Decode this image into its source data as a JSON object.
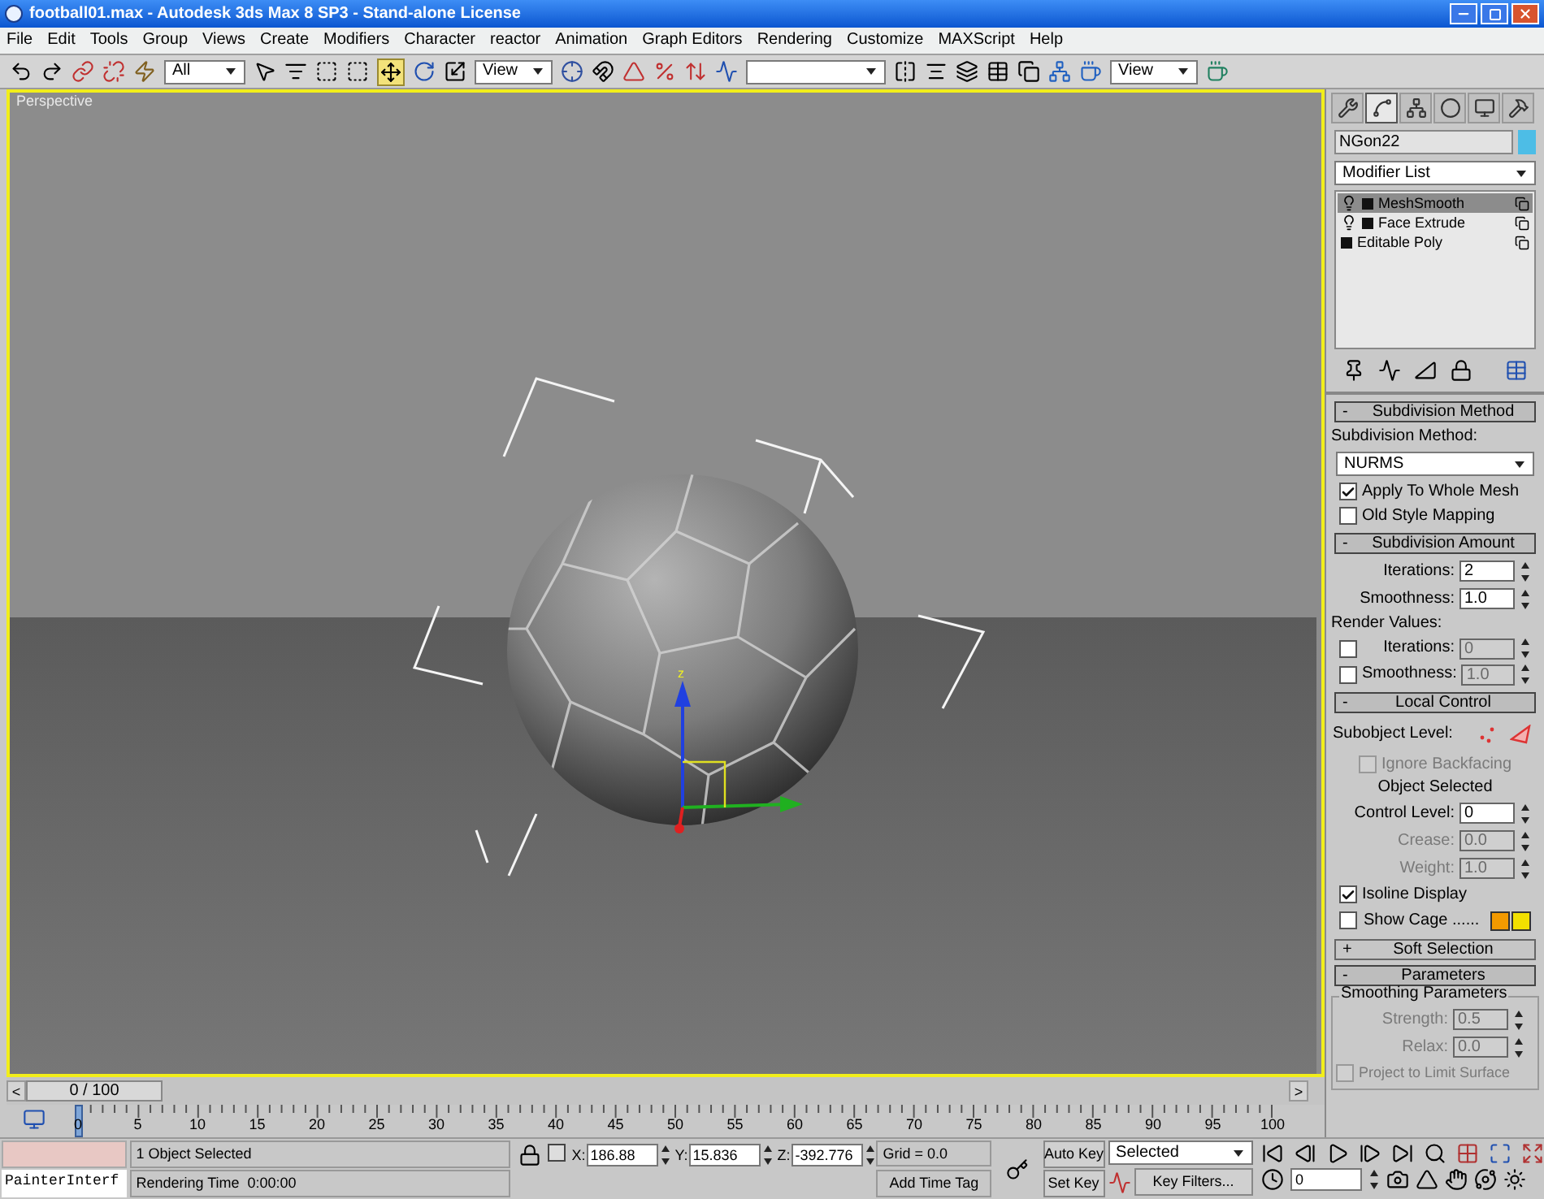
{
  "window": {
    "title": "football01.max - Autodesk 3ds Max 8 SP3  - Stand-alone License"
  },
  "menu": [
    "File",
    "Edit",
    "Tools",
    "Group",
    "Views",
    "Create",
    "Modifiers",
    "Character",
    "reactor",
    "Animation",
    "Graph Editors",
    "Rendering",
    "Customize",
    "MAXScript",
    "Help"
  ],
  "toolbar": {
    "selection_filter": "All",
    "reference_coordinate": "View",
    "render_viewport": "View"
  },
  "viewport": {
    "label": "Perspective",
    "gizmo_axis": "z"
  },
  "command_panel": {
    "tabs": [
      {
        "selected": false
      },
      {
        "selected": true
      },
      {
        "selected": false
      },
      {
        "selected": false
      },
      {
        "selected": false
      },
      {
        "selected": false
      }
    ],
    "object_name": "NGon22",
    "modifier_list": "Modifier List",
    "stack": [
      {
        "label": "MeshSmooth",
        "bulb": true,
        "selected": true
      },
      {
        "label": "Face Extrude",
        "bulb": true,
        "selected": false
      },
      {
        "label": "Editable Poly",
        "bulb": false,
        "selected": false
      }
    ],
    "rollouts": [
      {
        "sign": "-",
        "title": "Subdivision Method",
        "expanded": true,
        "controls": [
          {
            "kind": "label",
            "text": "Subdivision Method:"
          },
          {
            "kind": "dropdown",
            "value": "NURMS"
          },
          {
            "kind": "checkbox",
            "label": "Apply To Whole Mesh",
            "checked": true,
            "disabled": false
          },
          {
            "kind": "checkbox",
            "label": "Old Style Mapping",
            "checked": false,
            "disabled": false
          }
        ]
      },
      {
        "sign": "-",
        "title": "Subdivision Amount",
        "expanded": true,
        "controls": [
          {
            "kind": "spinner",
            "label": "Iterations:",
            "value": "2",
            "disabled": false
          },
          {
            "kind": "spinner",
            "label": "Smoothness:",
            "value": "1.0",
            "disabled": false
          },
          {
            "kind": "label",
            "text": "Render Values:"
          },
          {
            "kind": "check_spinner",
            "label": "Iterations:",
            "value": "0",
            "checked": false,
            "disabled": true
          },
          {
            "kind": "check_spinner",
            "label": "Smoothness:",
            "value": "1.0",
            "checked": false,
            "disabled": true
          }
        ]
      },
      {
        "sign": "-",
        "title": "Local Control",
        "expanded": true,
        "controls": [
          {
            "kind": "subobject",
            "label": "Subobject Level:"
          },
          {
            "kind": "checkbox",
            "label": "Ignore Backfacing",
            "checked": false,
            "disabled": true
          },
          {
            "kind": "note",
            "text": "Object Selected"
          },
          {
            "kind": "spinner",
            "label": "Control Level:",
            "value": "0",
            "disabled": false
          },
          {
            "kind": "spinner",
            "label": "Crease:",
            "value": "0.0",
            "disabled": true
          },
          {
            "kind": "spinner",
            "label": "Weight:",
            "value": "1.0",
            "disabled": true
          },
          {
            "kind": "checkbox",
            "label": "Isoline Display",
            "checked": true,
            "disabled": false
          },
          {
            "kind": "swatch_check",
            "label": "Show Cage ......",
            "checked": false,
            "disabled": false,
            "swatches": [
              {
                "color": "#f39a00"
              },
              {
                "color": "#f2e000"
              }
            ]
          }
        ]
      },
      {
        "sign": "+",
        "title": "Soft Selection",
        "expanded": false
      },
      {
        "sign": "-",
        "title": "Parameters",
        "expanded": true,
        "controls": [
          {
            "kind": "group",
            "title": "Smoothing Parameters",
            "controls": [
              {
                "kind": "spinner",
                "label": "Strength:",
                "value": "0.5",
                "disabled": true
              },
              {
                "kind": "spinner",
                "label": "Relax:",
                "value": "0.0",
                "disabled": true
              },
              {
                "kind": "checkbox",
                "label": "Project to Limit Surface",
                "checked": false,
                "disabled": true
              }
            ]
          }
        ]
      }
    ]
  },
  "time_slider": {
    "prev": "<",
    "position": "0 / 100",
    "next": ">",
    "level": 0
  },
  "track_bar": {
    "ticks": [
      "0",
      "5",
      "10",
      "15",
      "20",
      "25",
      "30",
      "35",
      "40",
      "45",
      "50",
      "55",
      "60",
      "65",
      "70",
      "75",
      "80",
      "85",
      "90",
      "95",
      "100"
    ]
  },
  "status": {
    "script_listener": "PainterInterf",
    "prompt": "1 Object Selected",
    "render_time": "Rendering Time  0:00:00",
    "coords": [
      {
        "axis": "X:",
        "value": "186.88"
      },
      {
        "axis": "Y:",
        "value": "15.836"
      },
      {
        "axis": "Z:",
        "value": "-392.776"
      }
    ],
    "grid": "Grid = 0.0",
    "time_tag": "Add Time Tag",
    "auto_key": "Auto Key",
    "set_key": "Set Key",
    "key_mode": "Selected",
    "key_filters": "Key Filters...",
    "frame": "0"
  }
}
